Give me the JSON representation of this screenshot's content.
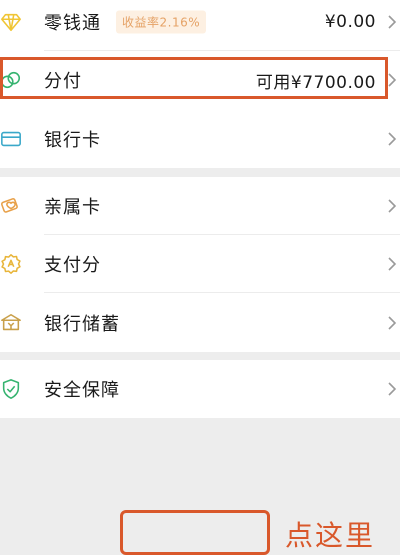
{
  "rows": {
    "change": {
      "label": "零钱通",
      "badge": "收益率2.16%",
      "value": "¥0.00"
    },
    "fenfu": {
      "label": "分付",
      "value": "可用¥7700.00"
    },
    "bankcard": {
      "label": "银行卡"
    },
    "family_card": {
      "label": "亲属卡"
    },
    "pay_score": {
      "label": "支付分"
    },
    "bank_savings": {
      "label": "银行储蓄"
    },
    "security": {
      "label": "安全保障"
    }
  },
  "annotation": {
    "text": "点这里"
  },
  "icons": {
    "change": "diamond-icon",
    "fenfu": "fenfu-icon",
    "bankcard": "card-icon",
    "family_card": "family-card-icon",
    "pay_score": "pay-score-icon",
    "bank_savings": "bank-icon",
    "security": "shield-icon"
  },
  "colors": {
    "accent_annotation": "#d9582b",
    "badge_text": "#e5a266",
    "badge_bg": "#fdf0e2"
  }
}
